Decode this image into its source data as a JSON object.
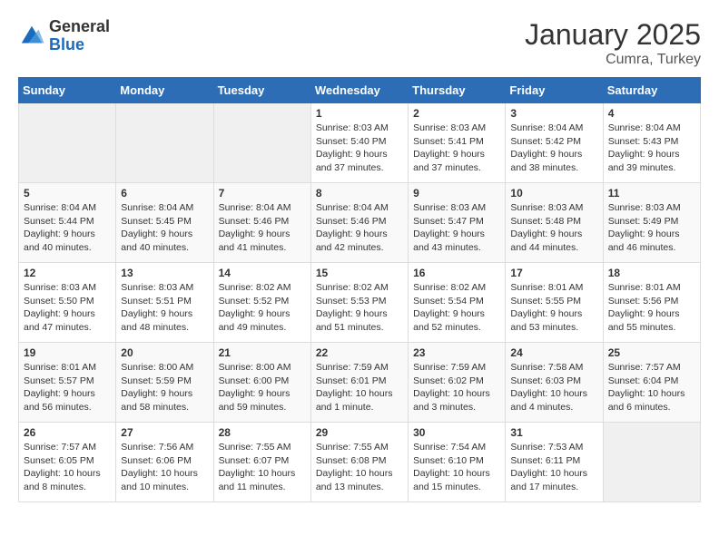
{
  "logo": {
    "general": "General",
    "blue": "Blue"
  },
  "title": "January 2025",
  "subtitle": "Cumra, Turkey",
  "days_of_week": [
    "Sunday",
    "Monday",
    "Tuesday",
    "Wednesday",
    "Thursday",
    "Friday",
    "Saturday"
  ],
  "weeks": [
    [
      {
        "day": "",
        "info": ""
      },
      {
        "day": "",
        "info": ""
      },
      {
        "day": "",
        "info": ""
      },
      {
        "day": "1",
        "info": "Sunrise: 8:03 AM\nSunset: 5:40 PM\nDaylight: 9 hours and 37 minutes."
      },
      {
        "day": "2",
        "info": "Sunrise: 8:03 AM\nSunset: 5:41 PM\nDaylight: 9 hours and 37 minutes."
      },
      {
        "day": "3",
        "info": "Sunrise: 8:04 AM\nSunset: 5:42 PM\nDaylight: 9 hours and 38 minutes."
      },
      {
        "day": "4",
        "info": "Sunrise: 8:04 AM\nSunset: 5:43 PM\nDaylight: 9 hours and 39 minutes."
      }
    ],
    [
      {
        "day": "5",
        "info": "Sunrise: 8:04 AM\nSunset: 5:44 PM\nDaylight: 9 hours and 40 minutes."
      },
      {
        "day": "6",
        "info": "Sunrise: 8:04 AM\nSunset: 5:45 PM\nDaylight: 9 hours and 40 minutes."
      },
      {
        "day": "7",
        "info": "Sunrise: 8:04 AM\nSunset: 5:46 PM\nDaylight: 9 hours and 41 minutes."
      },
      {
        "day": "8",
        "info": "Sunrise: 8:04 AM\nSunset: 5:46 PM\nDaylight: 9 hours and 42 minutes."
      },
      {
        "day": "9",
        "info": "Sunrise: 8:03 AM\nSunset: 5:47 PM\nDaylight: 9 hours and 43 minutes."
      },
      {
        "day": "10",
        "info": "Sunrise: 8:03 AM\nSunset: 5:48 PM\nDaylight: 9 hours and 44 minutes."
      },
      {
        "day": "11",
        "info": "Sunrise: 8:03 AM\nSunset: 5:49 PM\nDaylight: 9 hours and 46 minutes."
      }
    ],
    [
      {
        "day": "12",
        "info": "Sunrise: 8:03 AM\nSunset: 5:50 PM\nDaylight: 9 hours and 47 minutes."
      },
      {
        "day": "13",
        "info": "Sunrise: 8:03 AM\nSunset: 5:51 PM\nDaylight: 9 hours and 48 minutes."
      },
      {
        "day": "14",
        "info": "Sunrise: 8:02 AM\nSunset: 5:52 PM\nDaylight: 9 hours and 49 minutes."
      },
      {
        "day": "15",
        "info": "Sunrise: 8:02 AM\nSunset: 5:53 PM\nDaylight: 9 hours and 51 minutes."
      },
      {
        "day": "16",
        "info": "Sunrise: 8:02 AM\nSunset: 5:54 PM\nDaylight: 9 hours and 52 minutes."
      },
      {
        "day": "17",
        "info": "Sunrise: 8:01 AM\nSunset: 5:55 PM\nDaylight: 9 hours and 53 minutes."
      },
      {
        "day": "18",
        "info": "Sunrise: 8:01 AM\nSunset: 5:56 PM\nDaylight: 9 hours and 55 minutes."
      }
    ],
    [
      {
        "day": "19",
        "info": "Sunrise: 8:01 AM\nSunset: 5:57 PM\nDaylight: 9 hours and 56 minutes."
      },
      {
        "day": "20",
        "info": "Sunrise: 8:00 AM\nSunset: 5:59 PM\nDaylight: 9 hours and 58 minutes."
      },
      {
        "day": "21",
        "info": "Sunrise: 8:00 AM\nSunset: 6:00 PM\nDaylight: 9 hours and 59 minutes."
      },
      {
        "day": "22",
        "info": "Sunrise: 7:59 AM\nSunset: 6:01 PM\nDaylight: 10 hours and 1 minute."
      },
      {
        "day": "23",
        "info": "Sunrise: 7:59 AM\nSunset: 6:02 PM\nDaylight: 10 hours and 3 minutes."
      },
      {
        "day": "24",
        "info": "Sunrise: 7:58 AM\nSunset: 6:03 PM\nDaylight: 10 hours and 4 minutes."
      },
      {
        "day": "25",
        "info": "Sunrise: 7:57 AM\nSunset: 6:04 PM\nDaylight: 10 hours and 6 minutes."
      }
    ],
    [
      {
        "day": "26",
        "info": "Sunrise: 7:57 AM\nSunset: 6:05 PM\nDaylight: 10 hours and 8 minutes."
      },
      {
        "day": "27",
        "info": "Sunrise: 7:56 AM\nSunset: 6:06 PM\nDaylight: 10 hours and 10 minutes."
      },
      {
        "day": "28",
        "info": "Sunrise: 7:55 AM\nSunset: 6:07 PM\nDaylight: 10 hours and 11 minutes."
      },
      {
        "day": "29",
        "info": "Sunrise: 7:55 AM\nSunset: 6:08 PM\nDaylight: 10 hours and 13 minutes."
      },
      {
        "day": "30",
        "info": "Sunrise: 7:54 AM\nSunset: 6:10 PM\nDaylight: 10 hours and 15 minutes."
      },
      {
        "day": "31",
        "info": "Sunrise: 7:53 AM\nSunset: 6:11 PM\nDaylight: 10 hours and 17 minutes."
      },
      {
        "day": "",
        "info": ""
      }
    ]
  ]
}
